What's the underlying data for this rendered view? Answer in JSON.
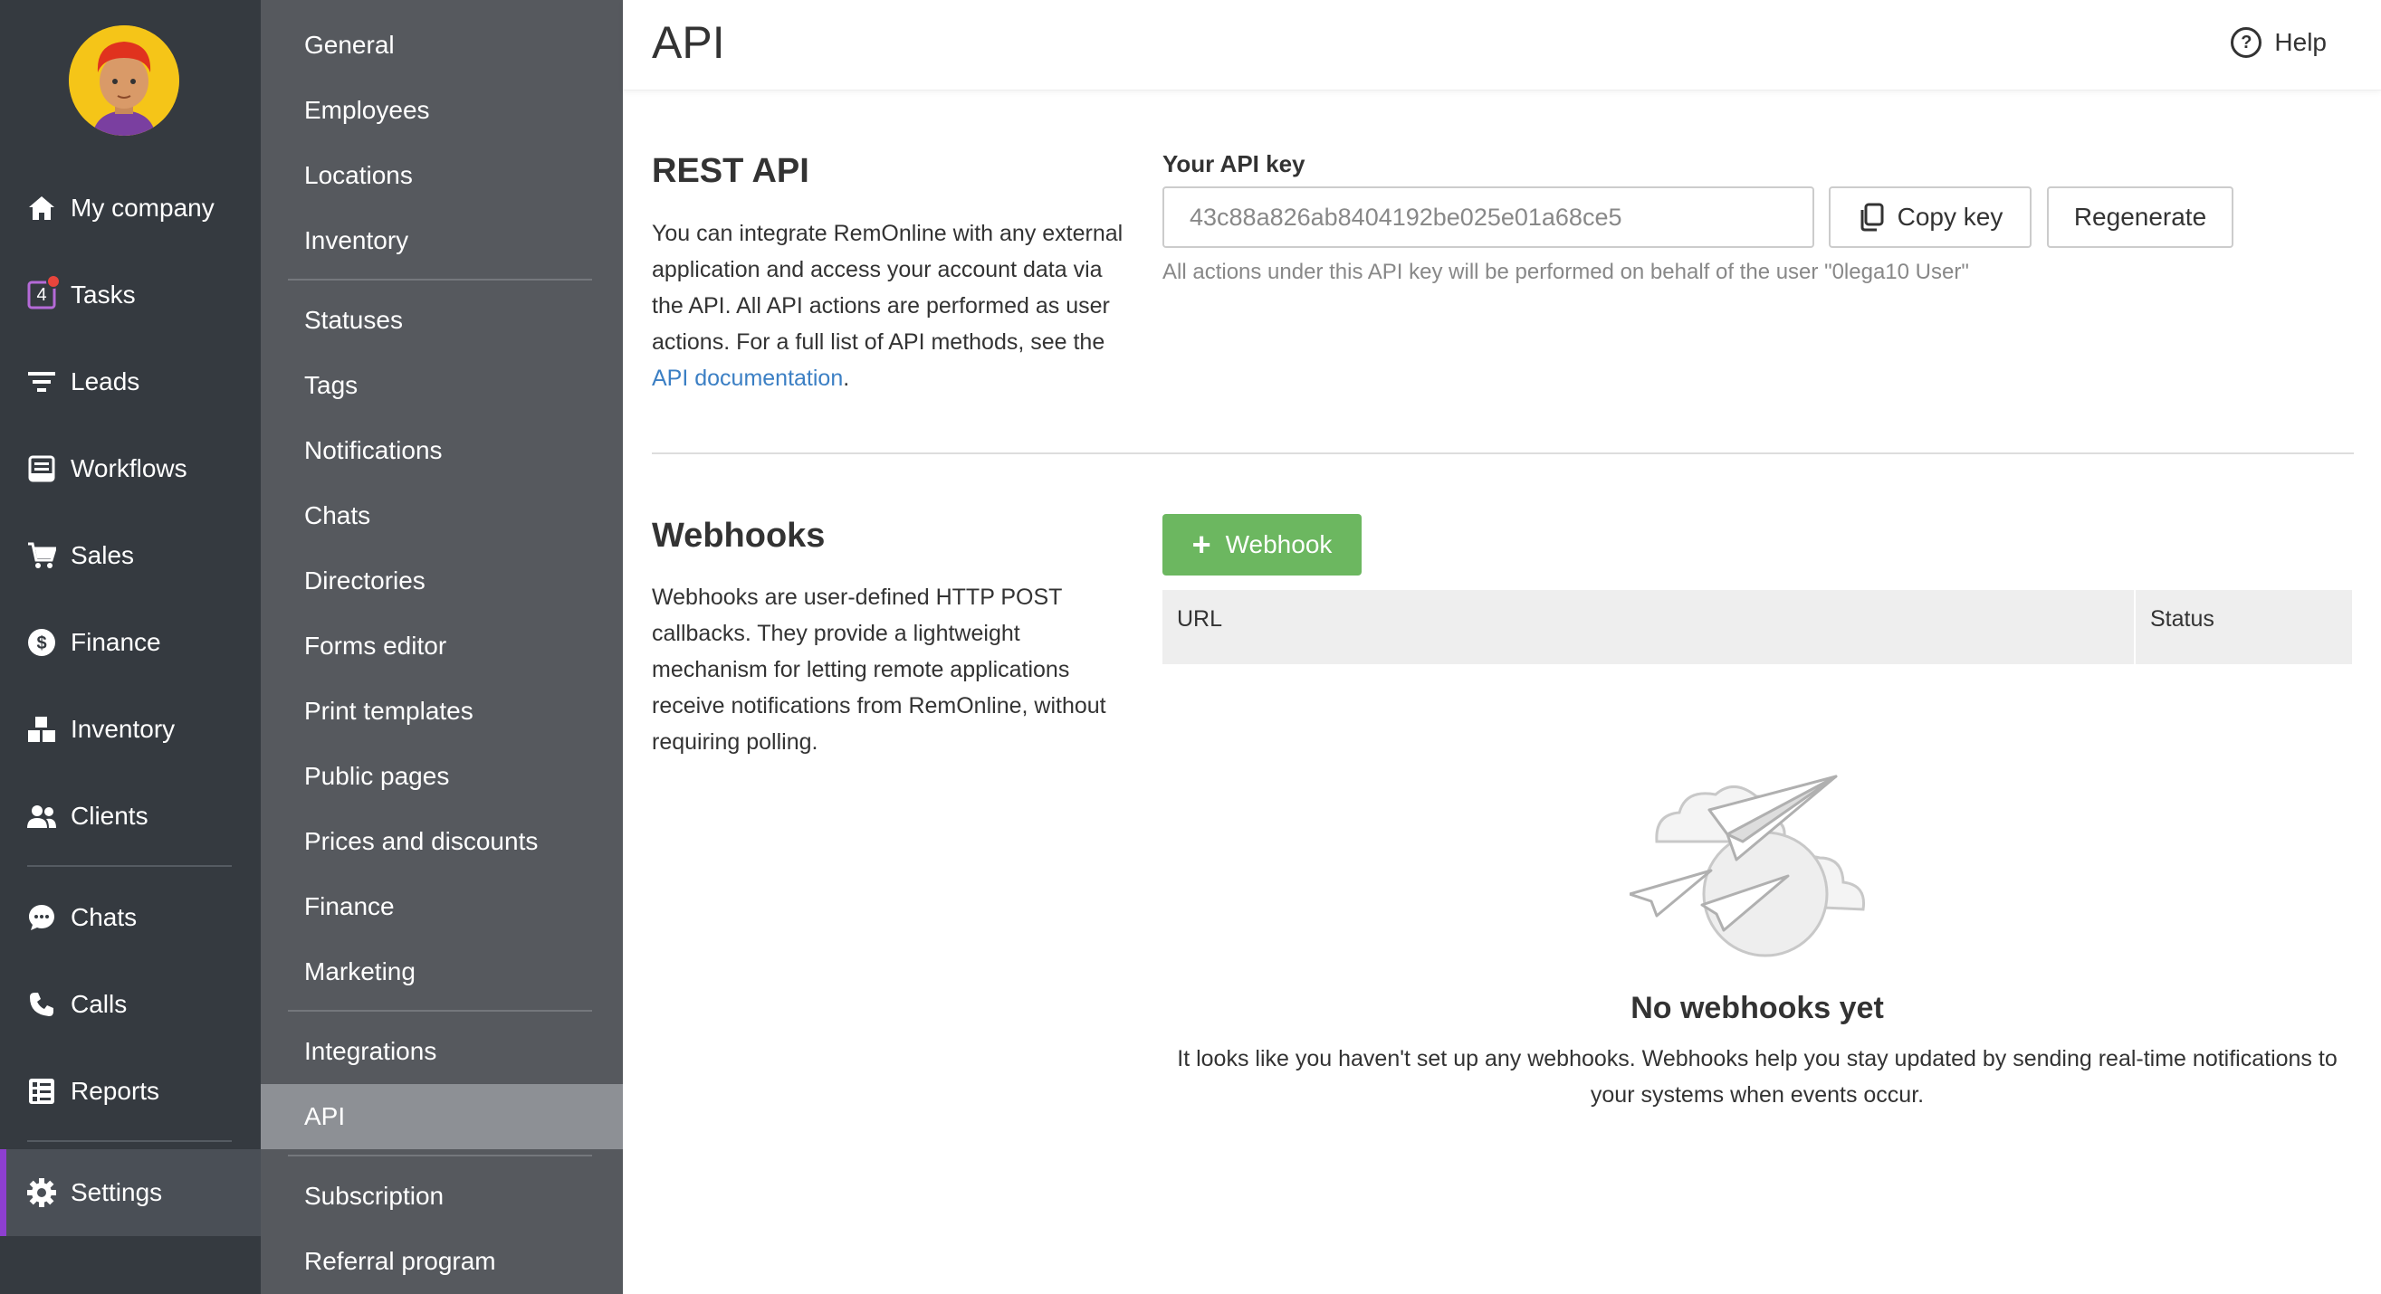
{
  "main_nav": {
    "items": [
      {
        "label": "My company",
        "icon": "home-icon"
      },
      {
        "label": "Tasks",
        "icon": "tasks-icon",
        "badge": "4"
      },
      {
        "label": "Leads",
        "icon": "leads-filter-icon"
      },
      {
        "label": "Workflows",
        "icon": "workflows-icon"
      },
      {
        "label": "Sales",
        "icon": "cart-icon"
      },
      {
        "label": "Finance",
        "icon": "dollar-icon"
      },
      {
        "label": "Inventory",
        "icon": "inventory-boxes-icon"
      },
      {
        "label": "Clients",
        "icon": "clients-icon"
      },
      {
        "label": "Chats",
        "icon": "chat-bubble-icon"
      },
      {
        "label": "Calls",
        "icon": "phone-icon"
      },
      {
        "label": "Reports",
        "icon": "reports-icon"
      },
      {
        "label": "Settings",
        "icon": "gear-icon",
        "active": true
      }
    ]
  },
  "sub_nav": {
    "items": [
      {
        "label": "General"
      },
      {
        "label": "Employees"
      },
      {
        "label": "Locations"
      },
      {
        "label": "Inventory"
      },
      {
        "label": "Statuses"
      },
      {
        "label": "Tags"
      },
      {
        "label": "Notifications"
      },
      {
        "label": "Chats"
      },
      {
        "label": "Directories"
      },
      {
        "label": "Forms editor"
      },
      {
        "label": "Print templates"
      },
      {
        "label": "Public pages"
      },
      {
        "label": "Prices and discounts"
      },
      {
        "label": "Finance"
      },
      {
        "label": "Marketing"
      },
      {
        "label": "Integrations"
      },
      {
        "label": "API",
        "active": true
      },
      {
        "label": "Subscription"
      },
      {
        "label": "Referral program"
      }
    ]
  },
  "header": {
    "title": "API",
    "help_label": "Help"
  },
  "rest_api": {
    "title": "REST API",
    "description": "You can integrate RemOnline with any external application and access your account data via the API. All API actions are performed as user actions. For a full list of API methods, see the ",
    "doc_link": "API documentation",
    "doc_suffix": ".",
    "key_label": "Your API key",
    "key_value": "43c88a826ab8404192be025e01a68ce5",
    "copy_label": "Copy key",
    "regenerate_label": "Regenerate",
    "key_hint": "All actions under this API key will be performed on behalf of the user \"0lega10 User\""
  },
  "webhooks": {
    "title": "Webhooks",
    "description": "Webhooks are user-defined HTTP POST callbacks. They provide a lightweight mechanism for letting remote applications receive notifications from RemOnline, without requiring polling.",
    "add_label": "Webhook",
    "columns": [
      "URL",
      "Status"
    ],
    "empty_title": "No webhooks yet",
    "empty_text": "It looks like you haven't set up any webhooks. Webhooks help you stay updated by sending real-time notifications to your systems when events occur."
  },
  "colors": {
    "main_nav_bg": "#353a40",
    "sub_nav_bg": "#56595e",
    "active_accent": "#8e3fd0",
    "primary_green": "#6cb760",
    "link_blue": "#3b7fc4"
  }
}
